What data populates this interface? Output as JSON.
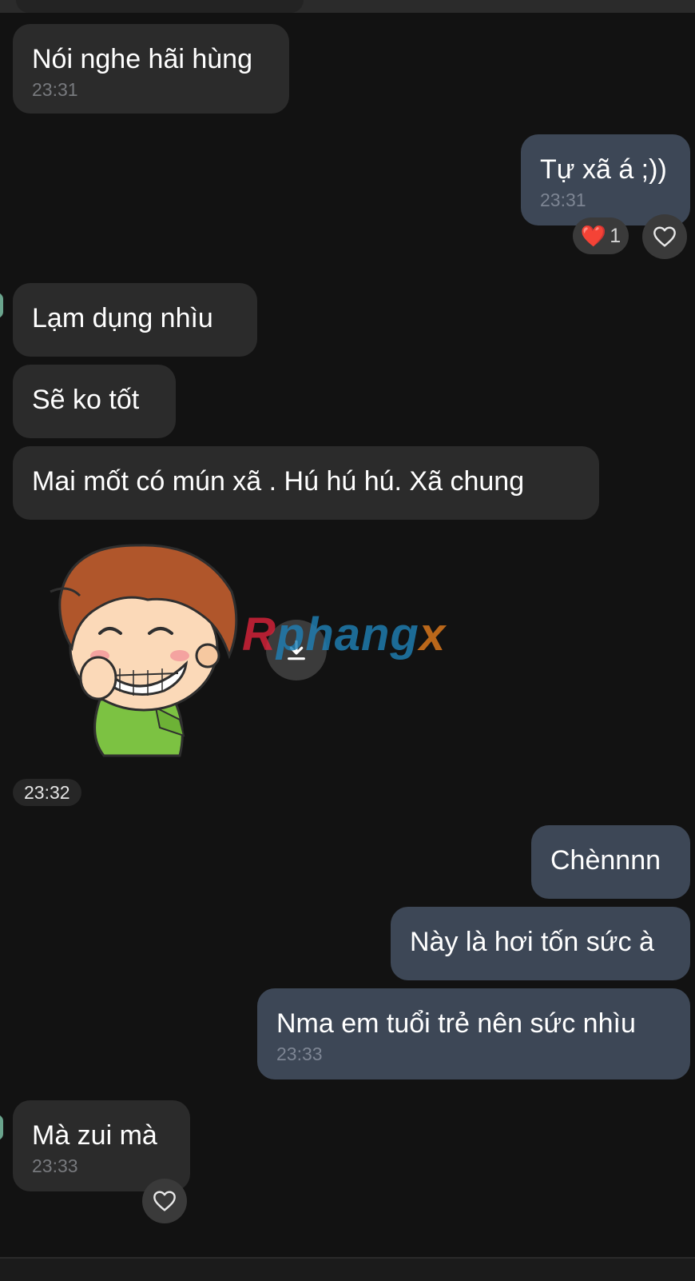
{
  "messages": [
    {
      "text": "Nói nghe hãi hùng",
      "time": "23:31"
    },
    {
      "text": "Tự xã á ;))",
      "time": "23:31",
      "reaction": {
        "emoji": "❤️",
        "count": "1"
      }
    },
    {
      "text": "Lạm dụng nhìu"
    },
    {
      "text": "Sẽ ko tốt"
    },
    {
      "text": "Mai mốt có mún xã . Hú hú hú.  Xã chung"
    },
    {
      "sticker": "boy-grinning-sticker",
      "time": "23:32"
    },
    {
      "text": "Chènnnn"
    },
    {
      "text": "Này là hơi tốn sức à"
    },
    {
      "text": "Nma em tuổi trẻ nên sức nhìu",
      "time": "23:33"
    },
    {
      "text": "Mà zui mà",
      "time": "23:33"
    }
  ],
  "watermark": {
    "first": "R",
    "middle": "phang",
    "last": "x"
  },
  "icons": {
    "like": "heart-outline-icon",
    "reaction": "red-heart-emoji",
    "download": "download-icon"
  },
  "colors": {
    "background": "#121212",
    "incoming_bubble": "#2b2b2b",
    "outgoing_bubble": "#3d4756",
    "time_text": "#77797d",
    "reaction_heart": "#e8283c"
  }
}
